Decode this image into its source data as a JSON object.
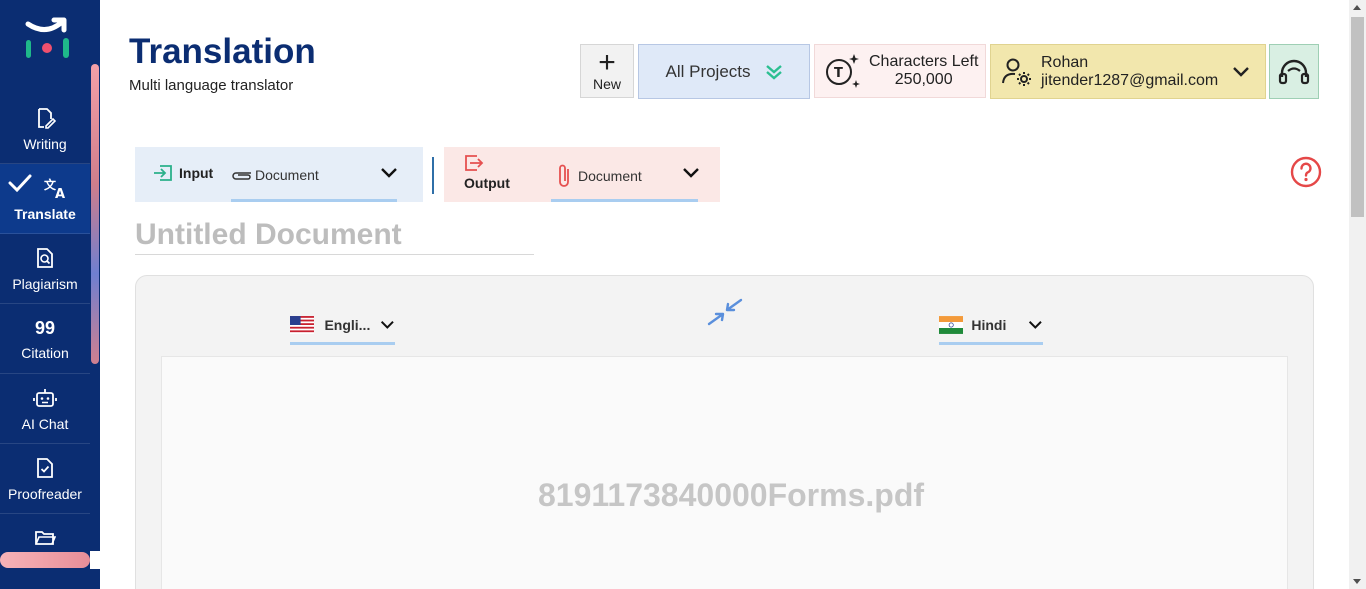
{
  "sidebar": {
    "items": [
      {
        "label": "Writing",
        "icon": "writing-icon"
      },
      {
        "label": "Translate",
        "icon": "translate-icon",
        "active": true
      },
      {
        "label": "Plagiarism",
        "icon": "plagiarism-icon"
      },
      {
        "label": "Citation",
        "icon": "citation-icon",
        "glyph": "99"
      },
      {
        "label": "AI Chat",
        "icon": "robot-icon"
      },
      {
        "label": "Proofreader",
        "icon": "proofreader-icon"
      },
      {
        "label": "",
        "icon": "folder-icon"
      }
    ]
  },
  "header": {
    "title": "Translation",
    "subtitle": "Multi language translator",
    "new_label": "New",
    "projects_label": "All Projects",
    "chars_label": "Characters Left",
    "chars_value": "250,000",
    "user_name": "Rohan",
    "user_email": "jitender1287@gmail.com"
  },
  "tabs": {
    "input_label": "Input",
    "input_type": "Document",
    "output_label": "Output",
    "output_type": "Document"
  },
  "document": {
    "title": "Untitled Document",
    "file_name": "8191173840000Forms.pdf"
  },
  "languages": {
    "source": "Engli...",
    "target": "Hindi"
  },
  "colors": {
    "sidebar_bg": "#0b2d72",
    "title": "#0b2d72",
    "accent_blue": "#a9cdf0",
    "help_red": "#e54848"
  }
}
